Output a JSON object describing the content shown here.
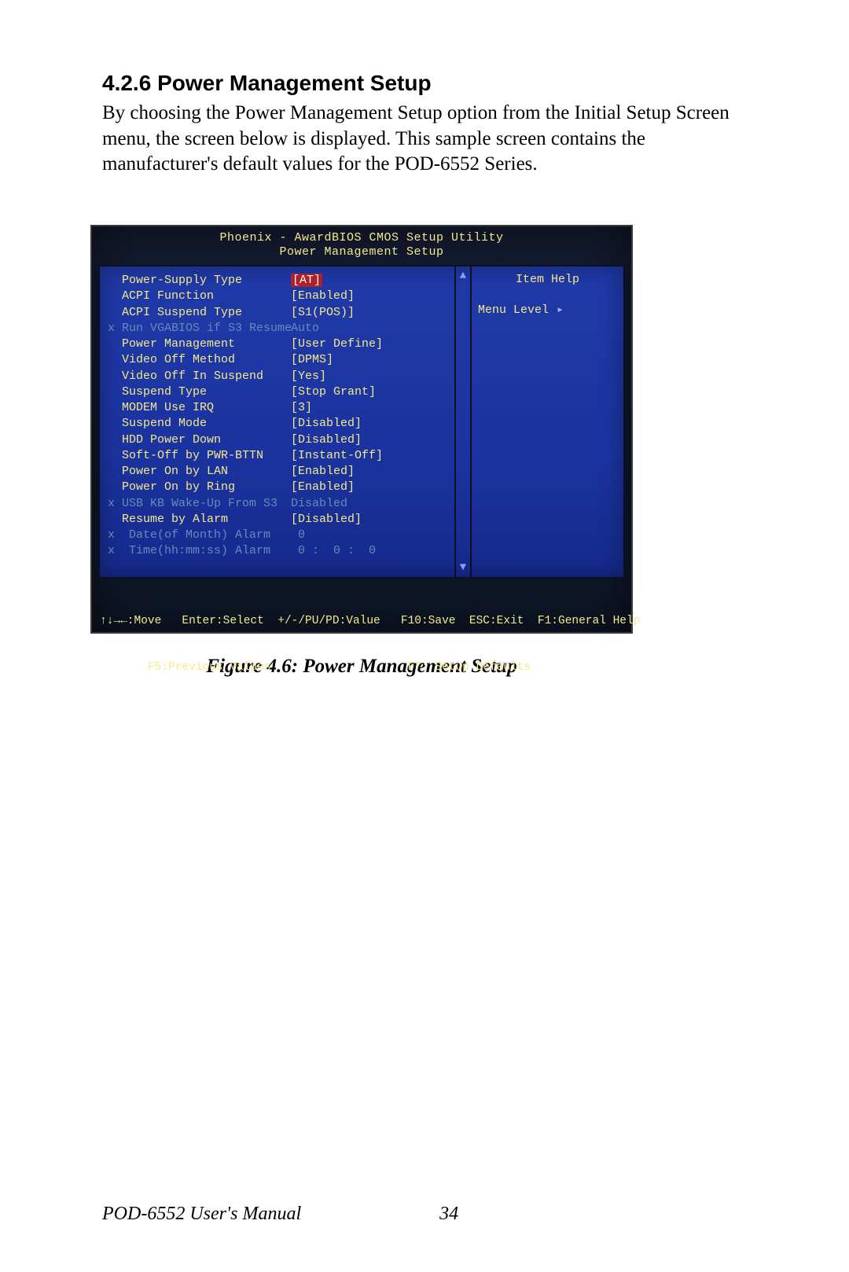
{
  "section": {
    "number": "4.2.6",
    "title": "Power Management Setup",
    "paragraph": "By choosing the Power Management Setup option from the Initial Setup Screen menu, the screen below is displayed. This sample screen contains the manufacturer's default values for the POD-6552 Series."
  },
  "bios": {
    "title1": "Phoenix - AwardBIOS CMOS Setup Utility",
    "title2": "Power Management Setup",
    "help_title": "Item Help",
    "menu_level": "Menu Level",
    "scroll_up": "▲",
    "scroll_down": "▼",
    "rows": [
      {
        "x": "",
        "label": "Power-Supply Type",
        "value": "[AT]",
        "dim": false,
        "selected": true,
        "val_dim": false
      },
      {
        "x": "",
        "label": "ACPI Function",
        "value": "[Enabled]",
        "dim": false,
        "selected": false,
        "val_dim": false
      },
      {
        "x": "",
        "label": "ACPI Suspend Type",
        "value": "[S1(POS)]",
        "dim": false,
        "selected": false,
        "val_dim": false
      },
      {
        "x": "x",
        "label": "Run VGABIOS if S3 Resume",
        "value": "Auto",
        "dim": true,
        "selected": false,
        "val_dim": true
      },
      {
        "x": "",
        "label": "Power Management",
        "value": "[User Define]",
        "dim": false,
        "selected": false,
        "val_dim": false
      },
      {
        "x": "",
        "label": "Video Off Method",
        "value": "[DPMS]",
        "dim": false,
        "selected": false,
        "val_dim": false
      },
      {
        "x": "",
        "label": "Video Off In Suspend",
        "value": "[Yes]",
        "dim": false,
        "selected": false,
        "val_dim": false
      },
      {
        "x": "",
        "label": "Suspend Type",
        "value": "[Stop Grant]",
        "dim": false,
        "selected": false,
        "val_dim": false
      },
      {
        "x": "",
        "label": "MODEM Use IRQ",
        "value": "[3]",
        "dim": false,
        "selected": false,
        "val_dim": false
      },
      {
        "x": "",
        "label": "Suspend Mode",
        "value": "[Disabled]",
        "dim": false,
        "selected": false,
        "val_dim": false
      },
      {
        "x": "",
        "label": "HDD Power Down",
        "value": "[Disabled]",
        "dim": false,
        "selected": false,
        "val_dim": false
      },
      {
        "x": "",
        "label": "Soft-Off by PWR-BTTN",
        "value": "[Instant-Off]",
        "dim": false,
        "selected": false,
        "val_dim": false
      },
      {
        "x": "",
        "label": "Power On by LAN",
        "value": "[Enabled]",
        "dim": false,
        "selected": false,
        "val_dim": false
      },
      {
        "x": "",
        "label": "Power On by Ring",
        "value": "[Enabled]",
        "dim": false,
        "selected": false,
        "val_dim": false
      },
      {
        "x": "x",
        "label": "USB KB Wake-Up From S3",
        "value": "Disabled",
        "dim": true,
        "selected": false,
        "val_dim": true
      },
      {
        "x": "",
        "label": "Resume by Alarm",
        "value": "[Disabled]",
        "dim": false,
        "selected": false,
        "val_dim": false
      },
      {
        "x": "x",
        "label": " Date(of Month) Alarm",
        "value": " 0",
        "dim": true,
        "selected": false,
        "val_dim": true
      },
      {
        "x": "x",
        "label": " Time(hh:mm:ss) Alarm",
        "value": " 0 :  0 :  0",
        "dim": true,
        "selected": false,
        "val_dim": true
      }
    ],
    "legend1": "↑↓→←:Move   Enter:Select  +/-/PU/PD:Value   F10:Save  ESC:Exit  F1:General Help",
    "legend2": "       F5:Previous Values                    F7: Setup Defaults"
  },
  "caption": "Figure 4.6: Power Management Setup",
  "footer": {
    "manual": "POD-6552 User's Manual",
    "page": "34"
  }
}
